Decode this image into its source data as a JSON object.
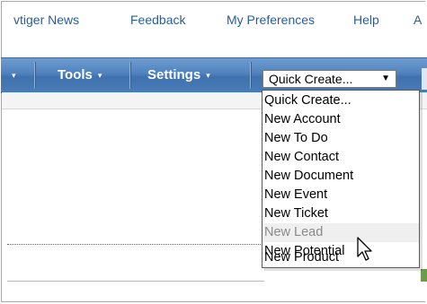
{
  "top_links": [
    "vtiger News",
    "Feedback",
    "My Preferences",
    "Help",
    "A"
  ],
  "nav": {
    "partial_caret": "▾",
    "tools_label": "Tools",
    "settings_label": "Settings",
    "caret": "▾"
  },
  "quick_create": {
    "selected": "Quick Create...",
    "arrow": "▼",
    "options": [
      "Quick Create...",
      "New Account",
      "New To Do",
      "New Contact",
      "New Document",
      "New Event",
      "New Ticket",
      "New Lead",
      "New Potential",
      "New Product"
    ],
    "hovered_option": "New Lead"
  },
  "colors": {
    "link": "#2a5d97",
    "navbar": "#4f82bd",
    "hover_text": "#8a8a8a"
  },
  "icons": {
    "cursor": "mouse-pointer-icon",
    "dropdown": "chevron-down-icon"
  }
}
